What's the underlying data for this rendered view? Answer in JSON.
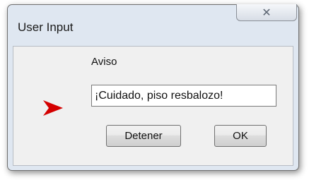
{
  "window": {
    "title": "User Input",
    "close_glyph": "✕"
  },
  "dialog": {
    "label": "Aviso",
    "input_value": "¡Cuidado, piso resbalozo!",
    "arrow_icon": "red-arrow-icon",
    "arrow_color": "#d40000"
  },
  "buttons": {
    "stop_label": "Detener",
    "ok_label": "OK"
  }
}
